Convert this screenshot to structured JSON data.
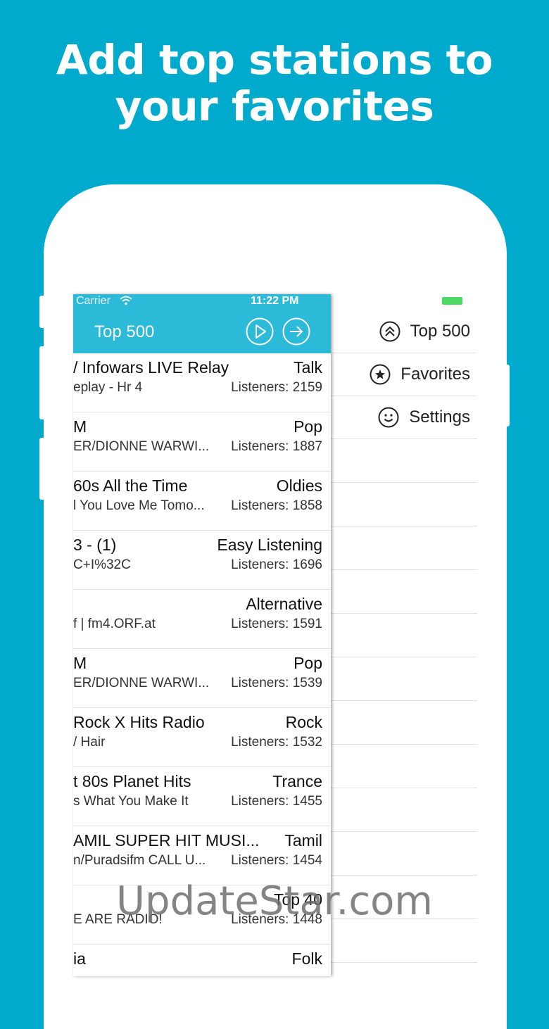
{
  "headline": {
    "line1": "Add top stations to",
    "line2": "your favorites"
  },
  "status": {
    "carrier": "Carrier",
    "time": "11:22 PM"
  },
  "navbar": {
    "title": "Top 500",
    "play_icon": "play-circle-icon",
    "next_icon": "arrow-right-circle-icon"
  },
  "stations": [
    {
      "name": "/ Infowars LIVE Relay",
      "genre": "Talk",
      "song": "eplay - Hr 4",
      "listeners": "Listeners: 2159"
    },
    {
      "name": "M",
      "genre": "Pop",
      "song": "ER/DIONNE WARWI...",
      "listeners": "Listeners: 1887"
    },
    {
      "name": "60s All the Time",
      "genre": "Oldies",
      "song": "l You Love Me Tomo...",
      "listeners": "Listeners: 1858"
    },
    {
      "name": "3 - (1)",
      "genre": "Easy Listening",
      "song": "C+I%32C",
      "listeners": "Listeners: 1696"
    },
    {
      "name": "",
      "genre": "Alternative",
      "song": "f | fm4.ORF.at",
      "listeners": "Listeners: 1591"
    },
    {
      "name": "M",
      "genre": "Pop",
      "song": "ER/DIONNE WARWI...",
      "listeners": "Listeners: 1539"
    },
    {
      "name": "Rock X Hits Radio",
      "genre": "Rock",
      "song": "/ Hair",
      "listeners": "Listeners: 1532"
    },
    {
      "name": "t 80s Planet Hits",
      "genre": "Trance",
      "song": "s What You Make It",
      "listeners": "Listeners: 1455"
    },
    {
      "name": "AMIL SUPER HIT MUSI...",
      "genre": "Tamil",
      "song": "n/Puradsifm CALL U...",
      "listeners": "Listeners: 1454"
    },
    {
      "name": "",
      "genre": "Top 40",
      "song": "E ARE RADIO!",
      "listeners": "Listeners: 1448"
    },
    {
      "name": "ia",
      "genre": "Folk",
      "song": "",
      "listeners": ""
    }
  ],
  "menu": [
    {
      "label": "Top 500",
      "icon": "double-chevron-up-circle-icon"
    },
    {
      "label": "Favorites",
      "icon": "star-circle-icon"
    },
    {
      "label": "Settings",
      "icon": "smiley-icon"
    }
  ],
  "watermark": "UpdateStar.com",
  "colors": {
    "background": "#00aacd",
    "navbar": "#2bbad8",
    "battery": "#4cd964"
  }
}
